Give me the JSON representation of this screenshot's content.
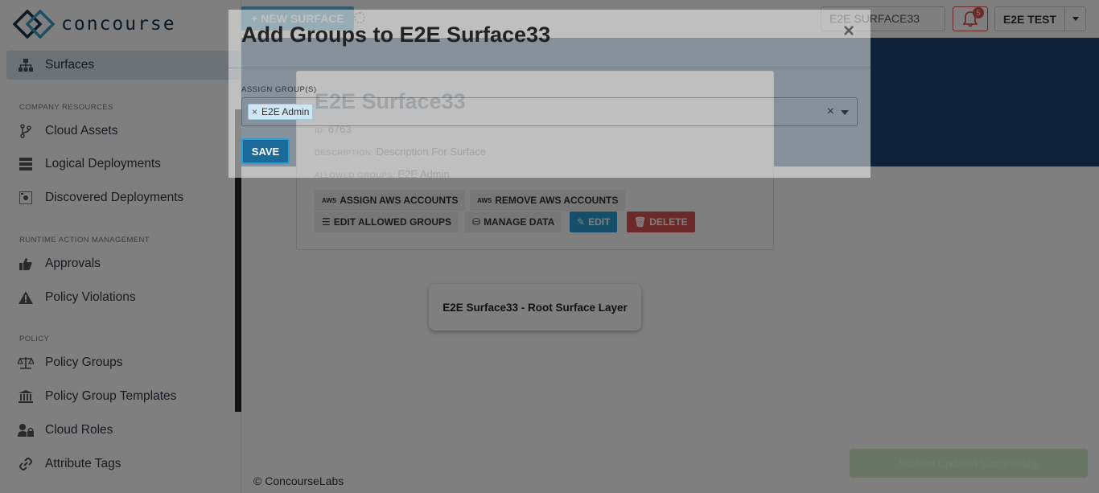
{
  "app": {
    "logo_text": "concourse"
  },
  "sidebar": {
    "items": [
      {
        "label": "Surfaces",
        "icon": "sitemap-icon",
        "active": true
      },
      {
        "label": "Cloud Assets",
        "icon": "code-branch-icon"
      },
      {
        "label": "Logical Deployments",
        "icon": "server-icon"
      },
      {
        "label": "Discovered Deployments",
        "icon": "radar-icon"
      },
      {
        "label": "Approvals",
        "icon": "thumbs-up-icon"
      },
      {
        "label": "Policy Violations",
        "icon": "warning-icon"
      },
      {
        "label": "Policy Groups",
        "icon": "balance-scale-icon"
      },
      {
        "label": "Policy Group Templates",
        "icon": "institution-icon"
      },
      {
        "label": "Cloud Roles",
        "icon": "user-lock-icon"
      },
      {
        "label": "Attribute Tags",
        "icon": "link-icon"
      }
    ],
    "sections": [
      "COMPANY RESOURCES",
      "RUNTIME ACTION MANAGEMENT",
      "POLICY"
    ]
  },
  "header": {
    "new_surface_label": "+ NEW SURFACE",
    "search_value": "E2E SURFACE33",
    "notification_count": "5",
    "user_label": "E2E TEST"
  },
  "surface_card": {
    "title": "E2E Surface33",
    "id_key": "ID:",
    "id_value": "6763",
    "description_key": "DESCRIPTION:",
    "description_value": "Description For Surface",
    "groups_key": "ALLOWED GROUPS:",
    "groups_value": "E2E Admin",
    "buttons": {
      "assign_aws": "ASSIGN AWS ACCOUNTS",
      "remove_aws": "REMOVE AWS ACCOUNTS",
      "edit_groups": "EDIT ALLOWED GROUPS",
      "manage_data": "MANAGE DATA",
      "edit": "EDIT",
      "delete": "DELETE"
    }
  },
  "root_layer": {
    "label": "E2E Surface33 - Root Surface Layer"
  },
  "footer": {
    "text": "© ConcourseLabs"
  },
  "toast": {
    "text": "Surface Updated Successfully"
  },
  "modal": {
    "title": "Add Groups to E2E Surface33",
    "close": "×",
    "assign_label": "ASSIGN GROUP(S)",
    "selected_tags": [
      "E2E Admin"
    ],
    "clear": "×",
    "save_label": "SAVE"
  },
  "colors": {
    "brand_dark": "#1b3550",
    "banner": "#1f4670",
    "primary": "#2a9fd6",
    "danger": "#d9534f"
  }
}
